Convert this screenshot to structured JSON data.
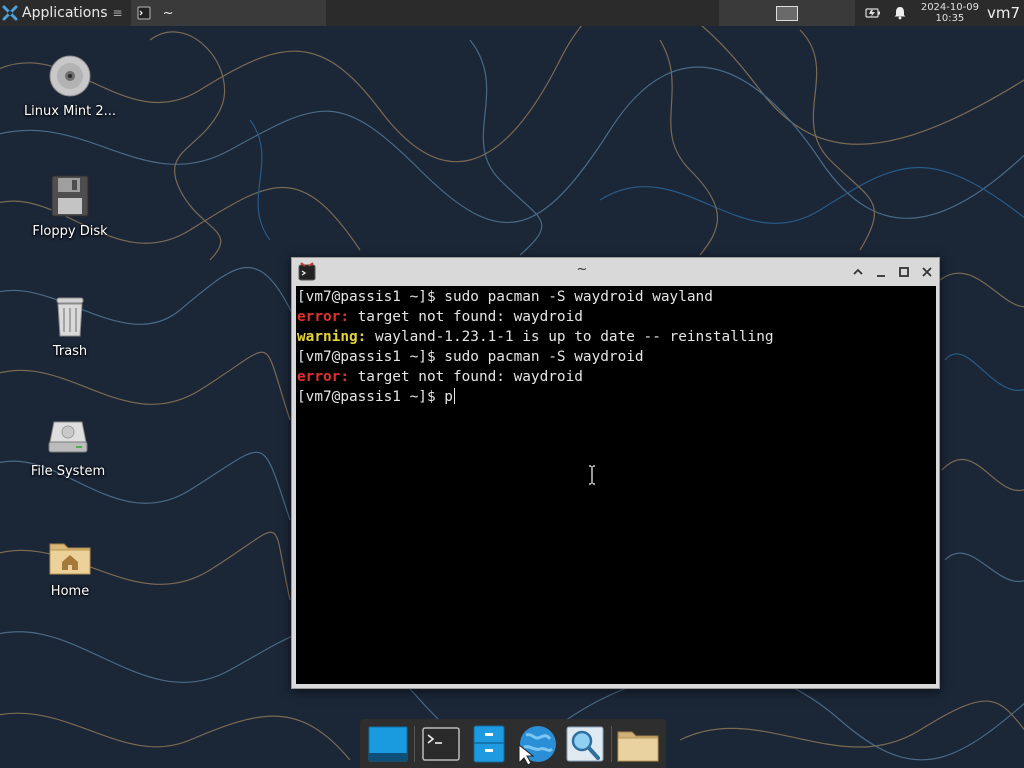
{
  "top_panel": {
    "applications_label": "Applications",
    "task_title": "~",
    "clock_date": "2024-10-09",
    "clock_time": "10:35",
    "user": "vm7"
  },
  "desktop_icons": [
    {
      "label": "Linux Mint 2...",
      "icon": "optical-disc-icon"
    },
    {
      "label": "Floppy Disk",
      "icon": "floppy-disk-icon"
    },
    {
      "label": "Trash",
      "icon": "trash-icon"
    },
    {
      "label": "File System",
      "icon": "hard-drive-icon"
    },
    {
      "label": "Home",
      "icon": "home-folder-icon"
    }
  ],
  "terminal": {
    "title": "~",
    "lines": [
      {
        "prompt": "[vm7@passis1 ~]$ ",
        "text": "sudo pacman -S waydroid wayland"
      },
      {
        "tag": "error:",
        "text": " target not found: waydroid"
      },
      {
        "tag": "warning:",
        "text": " wayland-1.23.1-1 is up to date -- reinstalling"
      },
      {
        "prompt": "[vm7@passis1 ~]$ ",
        "text": "sudo pacman -S waydroid"
      },
      {
        "tag": "error:",
        "text": " target not found: waydroid"
      },
      {
        "prompt": "[vm7@passis1 ~]$ ",
        "text": "p"
      }
    ]
  },
  "dock": [
    {
      "icon": "show-desktop-icon"
    },
    {
      "icon": "terminal-icon"
    },
    {
      "icon": "file-manager-icon"
    },
    {
      "icon": "web-browser-icon"
    },
    {
      "icon": "app-finder-icon"
    },
    {
      "icon": "folder-icon"
    }
  ],
  "colors": {
    "error": "#e0322f",
    "warning": "#e5d33a",
    "panel": "#2b2b2b",
    "desktop_bg": "#1b2637"
  }
}
